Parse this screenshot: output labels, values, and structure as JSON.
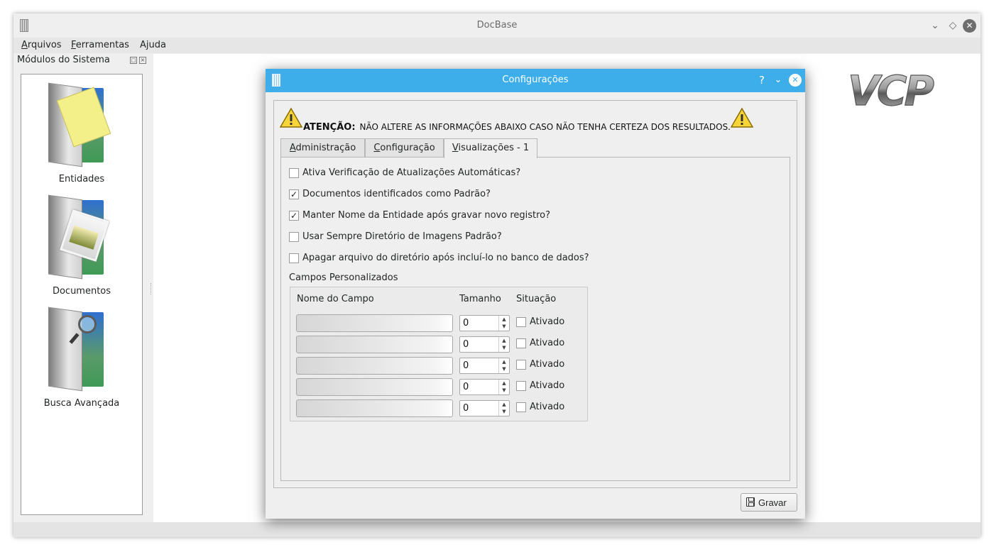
{
  "main_window": {
    "title": "DocBase",
    "menu": [
      {
        "accel": "A",
        "rest": "rquivos"
      },
      {
        "accel": "F",
        "rest": "erramentas"
      },
      {
        "pre": "A",
        "accel": "j",
        "rest": "uda"
      }
    ]
  },
  "dock": {
    "title": "Módulos do Sistema",
    "modules": [
      {
        "label": "Entidades",
        "icon": "folder-documents-icon"
      },
      {
        "label": "Documentos",
        "icon": "folder-images-icon"
      },
      {
        "label": "Busca Avançada",
        "icon": "folder-search-icon"
      }
    ]
  },
  "logo": {
    "text": "VCP"
  },
  "dialog": {
    "title": "Configurações",
    "warning": {
      "bold": "ATENÇÃO:",
      "text": "NÃO ALTERE AS INFORMAÇÕES ABAIXO CASO NÃO TENHA CERTEZA DOS RESULTADOS."
    },
    "tabs": [
      {
        "accel": "A",
        "rest": "dministração",
        "active": false
      },
      {
        "accel": "C",
        "rest": "onfiguração",
        "active": false
      },
      {
        "accel": "V",
        "rest": "isualizações - 1",
        "active": true
      }
    ],
    "options": [
      {
        "label": "Ativa Verificação de Atualizações Automáticas?",
        "checked": false
      },
      {
        "label": "Documentos identificados como Padrão?",
        "checked": true
      },
      {
        "label": "Manter Nome da Entidade após gravar novo registro?",
        "checked": true
      },
      {
        "label": "Usar Sempre Diretório de Imagens Padrão?",
        "checked": false
      },
      {
        "label": "Apagar arquivo do diretório após incluí-lo no banco de dados?",
        "checked": false
      }
    ],
    "custom_fields": {
      "title": "Campos Personalizados",
      "columns": {
        "name": "Nome do Campo",
        "size": "Tamanho",
        "status": "Situação"
      },
      "rows": [
        {
          "name": "",
          "size": "0",
          "status_label": "Ativado",
          "checked": false
        },
        {
          "name": "",
          "size": "0",
          "status_label": "Ativado",
          "checked": false
        },
        {
          "name": "",
          "size": "0",
          "status_label": "Ativado",
          "checked": false
        },
        {
          "name": "",
          "size": "0",
          "status_label": "Ativado",
          "checked": false
        },
        {
          "name": "",
          "size": "0",
          "status_label": "Ativado",
          "checked": false
        }
      ]
    },
    "save_label": "Gravar",
    "check_mark": "✓"
  },
  "colors": {
    "dialog_titlebar": "#3daee9",
    "window_bg": "#efefef"
  }
}
